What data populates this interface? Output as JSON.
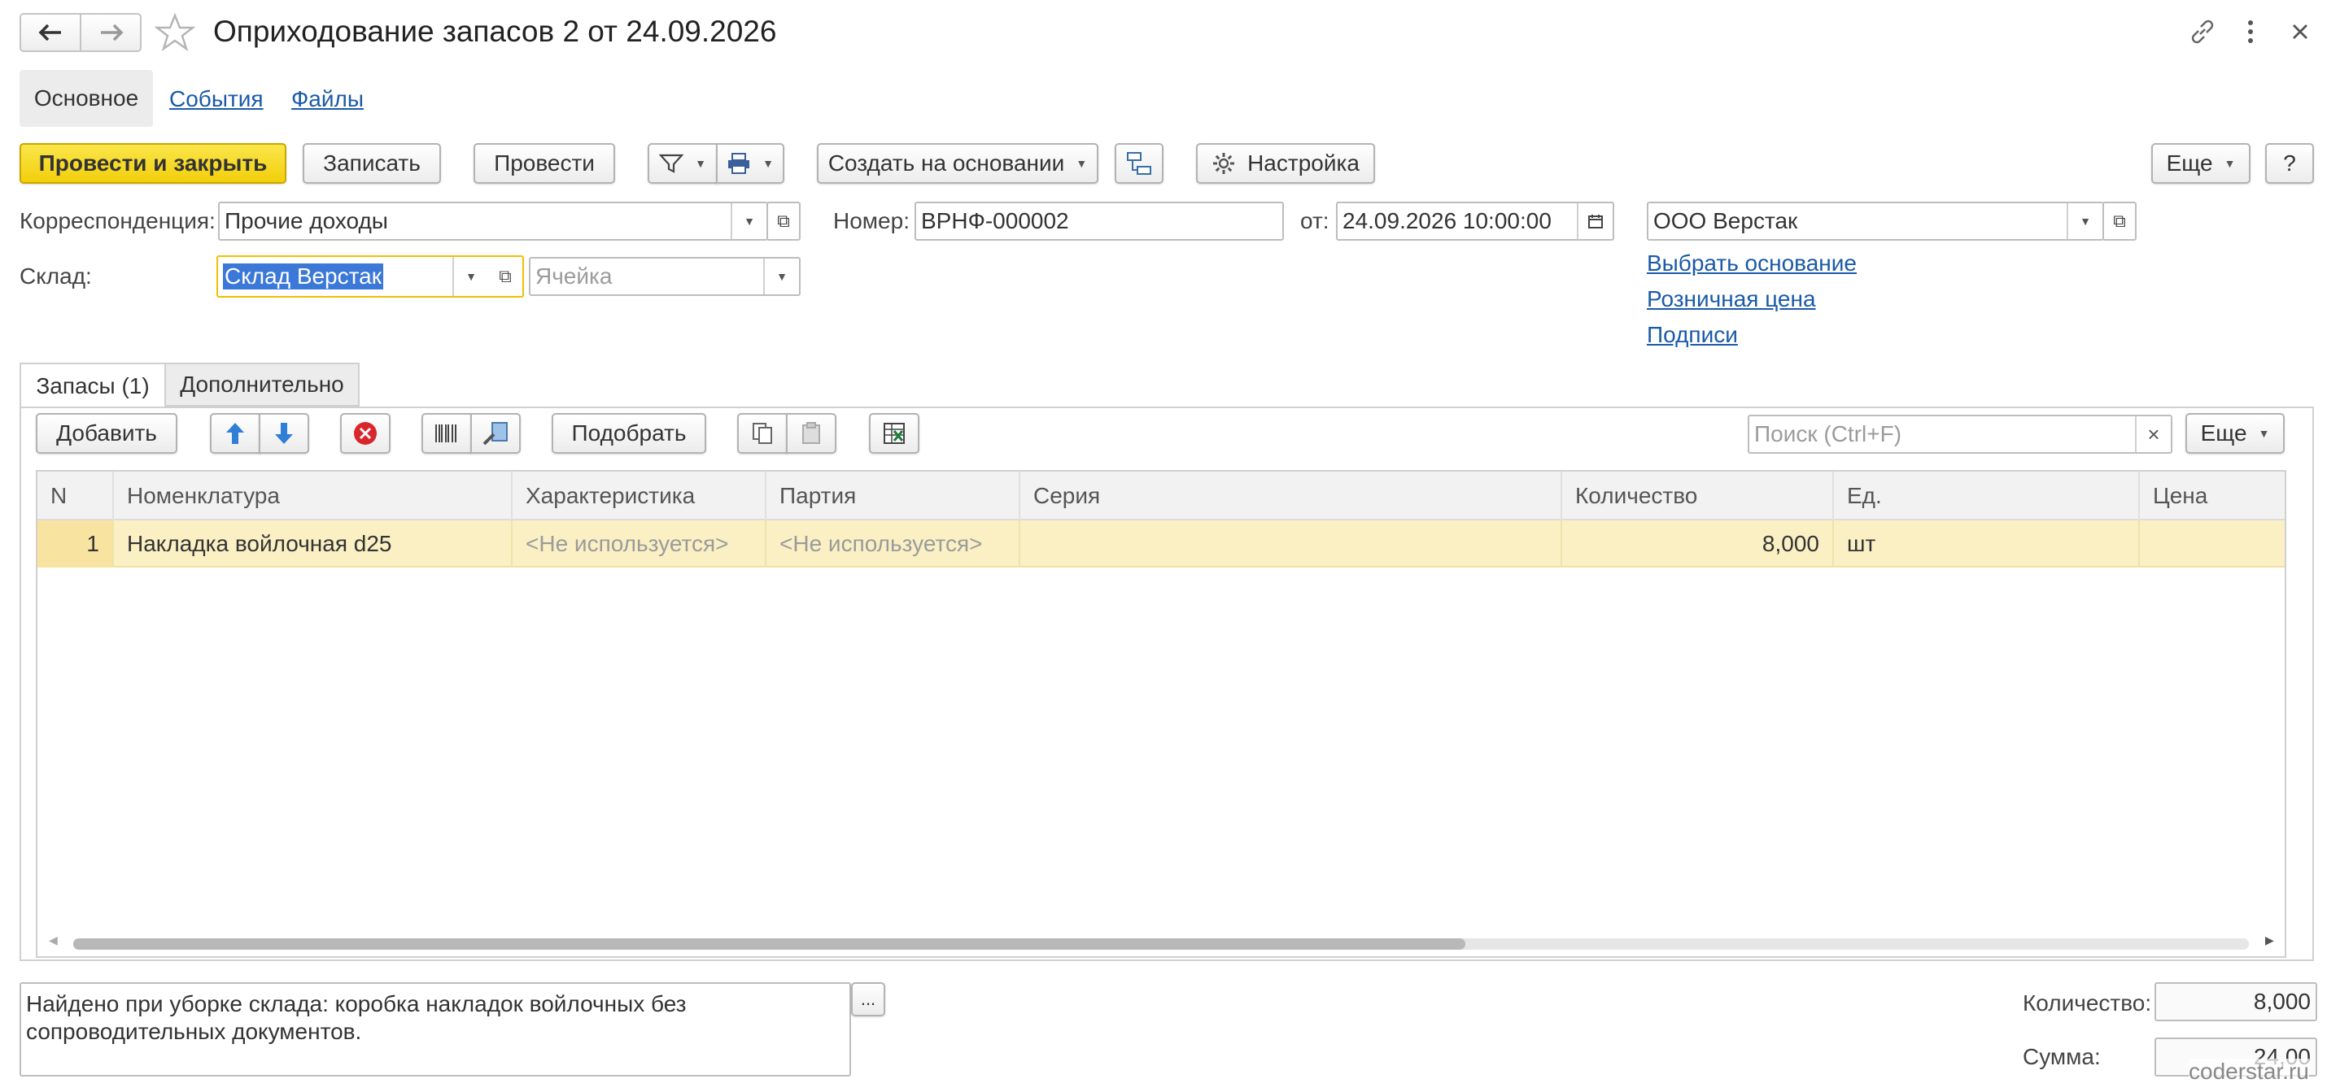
{
  "window": {
    "title": "Оприходование запасов 2 от 24.09.2026"
  },
  "nav_tabs": [
    {
      "label": "Основное"
    },
    {
      "label": "События"
    },
    {
      "label": "Файлы"
    }
  ],
  "toolbar": {
    "post_close": "Провести и закрыть",
    "save": "Записать",
    "post": "Провести",
    "create_based": "Создать на основании",
    "settings": "Настройка",
    "more": "Еще",
    "help": "?"
  },
  "form": {
    "correspondence_label": "Корреспонденция:",
    "correspondence_value": "Прочие доходы",
    "warehouse_label": "Склад:",
    "warehouse_value": "Склад Верстак",
    "cell_placeholder": "Ячейка",
    "number_label": "Номер:",
    "number_value": "ВРНФ-000002",
    "date_label": "от:",
    "date_value": "24.09.2026 10:00:00",
    "organization_value": "ООО Верстак",
    "links": [
      "Выбрать основание",
      "Розничная цена",
      "Подписи"
    ]
  },
  "inner_tabs": [
    {
      "label": "Запасы (1)"
    },
    {
      "label": "Дополнительно"
    }
  ],
  "table_toolbar": {
    "add": "Добавить",
    "pick": "Подобрать",
    "search_placeholder": "Поиск (Ctrl+F)",
    "more": "Еще"
  },
  "table": {
    "columns": [
      "N",
      "Номенклатура",
      "Характеристика",
      "Партия",
      "Серия",
      "Количество",
      "Ед.",
      "Цена"
    ],
    "rows": [
      {
        "n": "1",
        "item": "Накладка войлочная d25",
        "characteristic": "<Не используется>",
        "batch": "<Не используется>",
        "series": "",
        "qty": "8,000",
        "unit": "шт",
        "price": ""
      }
    ],
    "scroll_fraction": 0.64
  },
  "footer": {
    "comment": "Найдено при уборке склада: коробка накладок войлочных без сопроводительных документов.",
    "comment_button": "...",
    "qty_label": "Количество:",
    "qty_value": "8,000",
    "sum_label": "Сумма:",
    "sum_value": "24,00"
  },
  "watermark": "coderstar.ru",
  "colors": {
    "primary_button": "#f2cf0c",
    "selected_row": "#fbf0c4",
    "link": "#1a5aa8",
    "focus_border": "#f0c000"
  },
  "icons": [
    "back-arrow-icon",
    "forward-arrow-icon",
    "star-icon",
    "link-icon",
    "kebab-menu-icon",
    "close-icon",
    "filter-icon",
    "print-icon",
    "structure-icon",
    "gear-icon",
    "calendar-icon",
    "move-up-icon",
    "move-down-icon",
    "delete-icon",
    "barcode-icon",
    "scan-icon",
    "copy-icon",
    "paste-icon",
    "excel-icon"
  ]
}
